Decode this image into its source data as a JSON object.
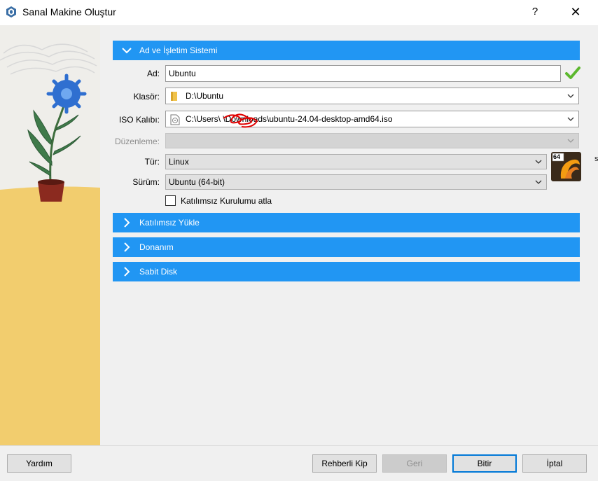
{
  "window": {
    "title": "Sanal Makine Oluştur",
    "help": "?",
    "close": "✕"
  },
  "sections": {
    "name_os": "Ad ve İşletim Sistemi",
    "unattended": "Katılımsız Yükle",
    "hardware": "Donanım",
    "disk": "Sabit Disk"
  },
  "form": {
    "name_label": "Ad:",
    "name_value": "Ubuntu",
    "folder_label": "Klasör:",
    "folder_value": "D:\\Ubuntu",
    "iso_label": "ISO Kalıbı:",
    "iso_value": "C:\\Users\\       \\Downloads\\ubuntu-24.04-desktop-amd64.iso",
    "edition_label": "Düzenleme:",
    "edition_value": "",
    "type_label": "Tür:",
    "type_value": "Linux",
    "version_label": "Sürüm:",
    "version_value": "Ubuntu (64-bit)",
    "skip_unattended_label": "Katılımsız Kurulumu atla",
    "skip_unattended_checked": false
  },
  "badge": {
    "arch": "64",
    "icon": "ubuntu-os-icon"
  },
  "stray_char": "s",
  "buttons": {
    "help": "Yardım",
    "guided": "Rehberli Kip",
    "back": "Geri",
    "finish": "Bitir",
    "cancel": "İptal"
  },
  "colors": {
    "section_header": "#2196f3",
    "panel_bg": "#f0f0f0",
    "valid_check": "#5cb82e",
    "illustration_sand": "#f2cd6e"
  }
}
